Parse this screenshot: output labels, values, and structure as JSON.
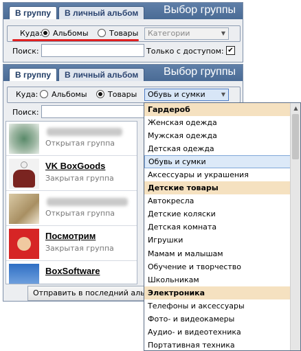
{
  "top_panel": {
    "tabs": [
      "В группу",
      "В личный альбом"
    ],
    "title": "Выбор группы",
    "where_label": "Куда:",
    "radio_albums": "Альбомы",
    "radio_goods": "Товары",
    "category_placeholder": "Категории",
    "search_label": "Поиск:",
    "access_label": "Только с доступом:",
    "access_checked": true
  },
  "bottom_panel": {
    "tabs": [
      "В группу",
      "В личный альбом"
    ],
    "title": "Выбор группы",
    "where_label": "Куда:",
    "radio_albums": "Альбомы",
    "radio_goods": "Товары",
    "category_value": "Обувь и сумки",
    "search_label": "Поиск:"
  },
  "groups": [
    {
      "name": "",
      "type": "Открытая группа",
      "name_blurred": true,
      "avatar_color": "#5a8a6a"
    },
    {
      "name": "VK BoxGoods",
      "type": "Закрытая группа",
      "name_blurred": false,
      "avatar_color": "#7a2420"
    },
    {
      "name": "",
      "type": "Открытая группа",
      "name_blurred": true,
      "avatar_color": "#b79b6a"
    },
    {
      "name": "Посмотрим",
      "type": "Закрытая группа",
      "name_blurred": false,
      "avatar_color": "#d62525"
    },
    {
      "name": "BoxSoftware",
      "type": "",
      "name_blurred": false,
      "avatar_color": "#2f6fc4"
    }
  ],
  "send_button_label": "Отправить в последний альбом",
  "dropdown": {
    "selected": "Обувь и сумки",
    "items": [
      {
        "label": "Гардероб",
        "header": true
      },
      {
        "label": "Женская одежда",
        "header": false
      },
      {
        "label": "Мужская одежда",
        "header": false
      },
      {
        "label": "Детская одежда",
        "header": false
      },
      {
        "label": "Обувь и сумки",
        "header": false
      },
      {
        "label": "Аксессуары и украшения",
        "header": false
      },
      {
        "label": "Детские товары",
        "header": true
      },
      {
        "label": "Автокресла",
        "header": false
      },
      {
        "label": "Детские коляски",
        "header": false
      },
      {
        "label": "Детская комната",
        "header": false
      },
      {
        "label": "Игрушки",
        "header": false
      },
      {
        "label": "Мамам и малышам",
        "header": false
      },
      {
        "label": "Обучение и творчество",
        "header": false
      },
      {
        "label": "Школьникам",
        "header": false
      },
      {
        "label": "Электроника",
        "header": true
      },
      {
        "label": "Телефоны и аксессуары",
        "header": false
      },
      {
        "label": "Фото- и видеокамеры",
        "header": false
      },
      {
        "label": "Аудио- и видеотехника",
        "header": false
      },
      {
        "label": "Портативная техника",
        "header": false
      }
    ]
  },
  "colors": {
    "titlebar": "#4a6b95",
    "header_row": "#f5e1c0",
    "selected_row": "#dce9f8",
    "annotation": "#e02020"
  }
}
